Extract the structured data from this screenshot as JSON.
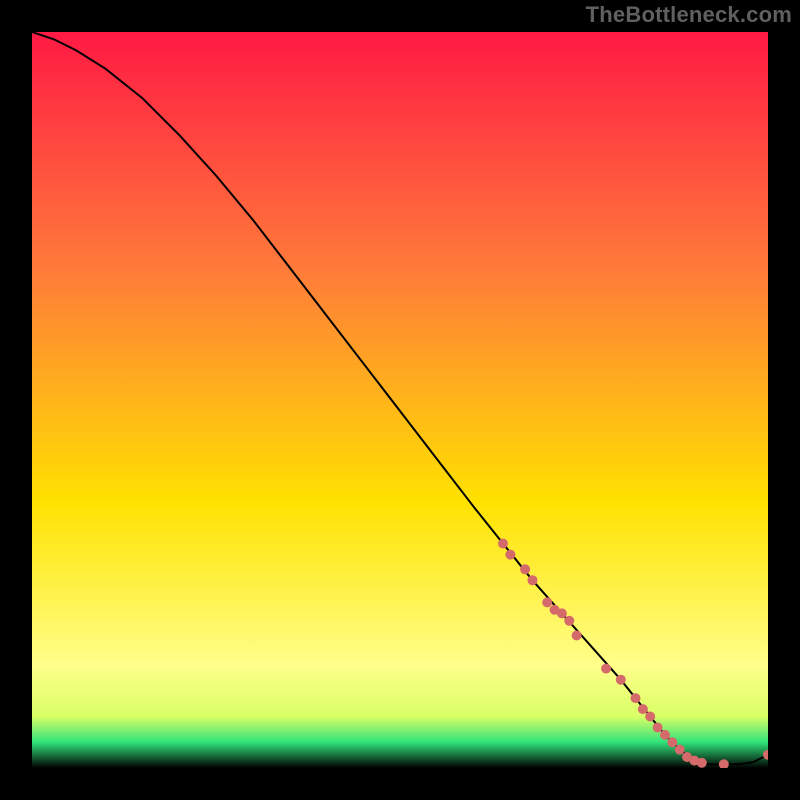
{
  "watermark": "TheBottleneck.com",
  "chart_data": {
    "type": "line",
    "title": "",
    "xlabel": "",
    "ylabel": "",
    "xlim": [
      0,
      100
    ],
    "ylim": [
      0,
      100
    ],
    "grid": false,
    "legend": false,
    "background_gradient": {
      "top": "#ff1a44",
      "mid1": "#ff7a3a",
      "mid2": "#ffe200",
      "low": "#ffff8a",
      "band": "#2fe37a",
      "base": "#000000"
    },
    "series": [
      {
        "name": "bottleneck-curve",
        "color": "#000000",
        "x": [
          0,
          3,
          6,
          10,
          15,
          20,
          25,
          30,
          35,
          40,
          45,
          50,
          55,
          60,
          64,
          68,
          72,
          76,
          80,
          82,
          84,
          86,
          88,
          90,
          92,
          94,
          96,
          98,
          100
        ],
        "y": [
          100,
          99,
          97.5,
          95,
          91,
          86,
          80.5,
          74.5,
          68,
          61.5,
          55,
          48.5,
          42,
          35.5,
          30.5,
          25.5,
          21,
          16.5,
          12,
          9.5,
          7,
          4.5,
          2.5,
          1,
          0.5,
          0.5,
          0.5,
          0.8,
          1.8
        ]
      }
    ],
    "points": {
      "name": "highlighted-points",
      "color": "#d46a6a",
      "x": [
        64,
        65,
        67,
        68,
        70,
        71,
        72,
        73,
        74,
        78,
        80,
        82,
        83,
        84,
        85,
        86,
        87,
        88,
        89,
        90,
        91,
        94,
        100
      ],
      "y": [
        30.5,
        29,
        27,
        25.5,
        22.5,
        21.5,
        21,
        20,
        18,
        13.5,
        12,
        9.5,
        8,
        7,
        5.5,
        4.5,
        3.5,
        2.5,
        1.5,
        1,
        0.7,
        0.5,
        1.8
      ]
    }
  }
}
